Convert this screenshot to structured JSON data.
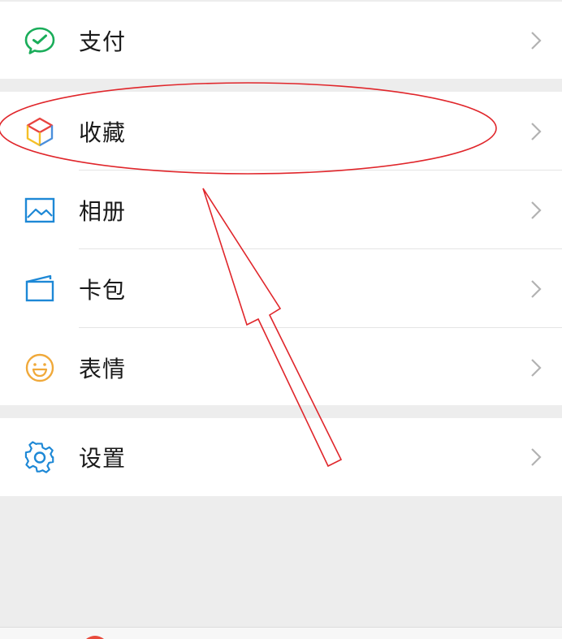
{
  "menu": {
    "pay": {
      "label": "支付",
      "icon": "wechat-pay-icon"
    },
    "favorites": {
      "label": "收藏",
      "icon": "favorites-cube-icon"
    },
    "album": {
      "label": "相册",
      "icon": "album-picture-icon"
    },
    "cards": {
      "label": "卡包",
      "icon": "card-wallet-icon"
    },
    "stickers": {
      "label": "表情",
      "icon": "sticker-smiley-icon"
    },
    "settings": {
      "label": "设置",
      "icon": "settings-gear-icon"
    }
  },
  "annotation": {
    "color": "#e0262b",
    "target": "favorites"
  },
  "colors": {
    "background": "#ededed",
    "row": "#ffffff",
    "text": "#1a1a1a",
    "chevron": "#b2b2b2",
    "pay_green": "#1aad5a",
    "album_blue": "#1d88d6",
    "sticker_orange": "#f0a93a"
  }
}
